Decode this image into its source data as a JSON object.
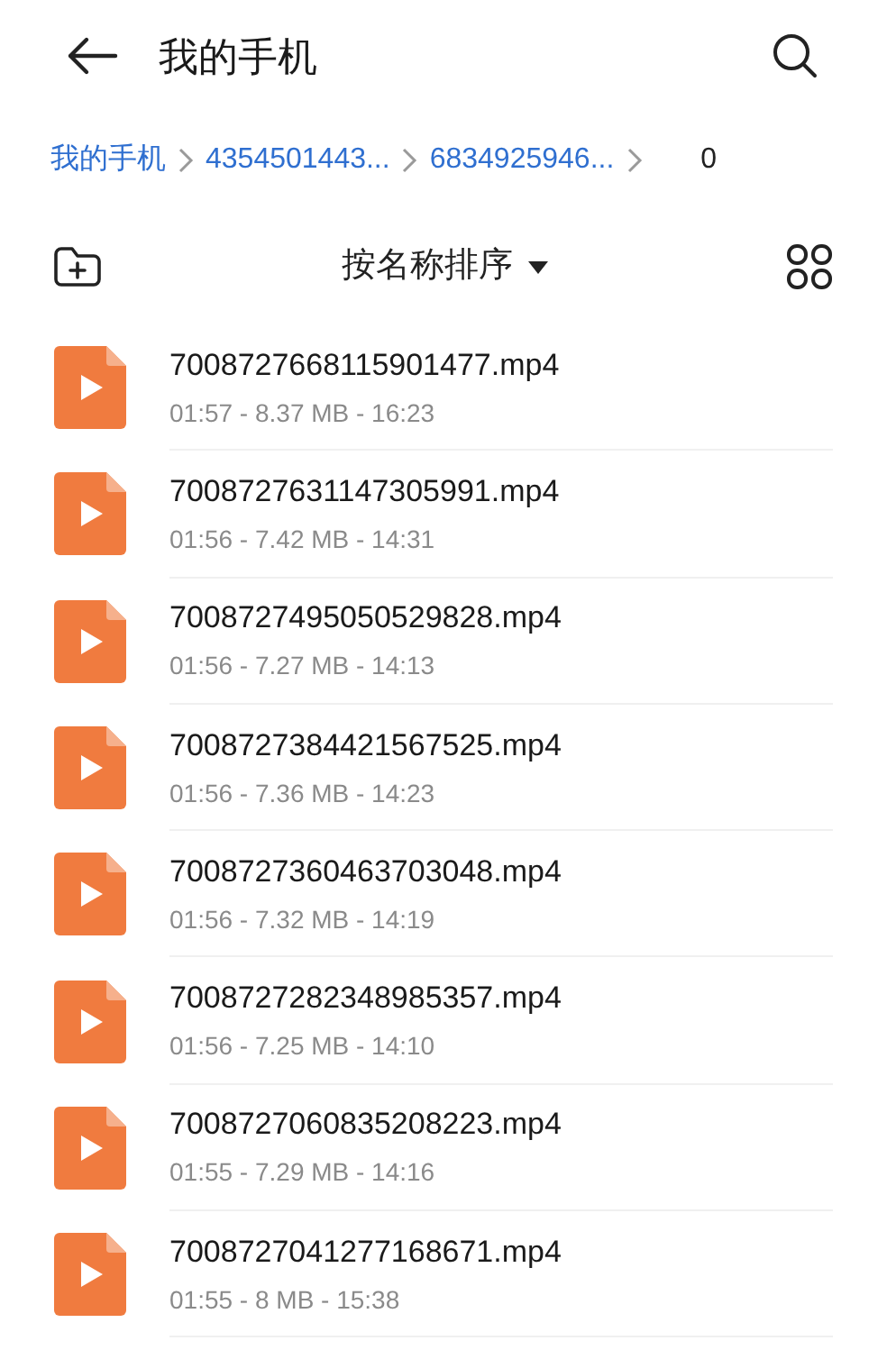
{
  "header": {
    "title": "我的手机"
  },
  "breadcrumbs": [
    {
      "label": "我的手机",
      "selected": false
    },
    {
      "label": "4354501443...",
      "selected": false
    },
    {
      "label": "6834925946...",
      "selected": false
    },
    {
      "label": "0",
      "selected": true
    }
  ],
  "toolbar": {
    "sort_label": "按名称排序"
  },
  "files": [
    {
      "name": "7008727668115901477.mp4",
      "meta": "01:57 - 8.37 MB - 16:23"
    },
    {
      "name": "7008727631147305991.mp4",
      "meta": "01:56 - 7.42 MB - 14:31"
    },
    {
      "name": "7008727495050529828.mp4",
      "meta": "01:56 - 7.27 MB - 14:13"
    },
    {
      "name": "7008727384421567525.mp4",
      "meta": "01:56 - 7.36 MB - 14:23"
    },
    {
      "name": "7008727360463703048.mp4",
      "meta": "01:56 - 7.32 MB - 14:19"
    },
    {
      "name": "7008727282348985357.mp4",
      "meta": "01:56 - 7.25 MB - 14:10"
    },
    {
      "name": "7008727060835208223.mp4",
      "meta": "01:55 - 7.29 MB - 14:16"
    },
    {
      "name": "7008727041277168671.mp4",
      "meta": "01:55 - 8 MB - 15:38"
    }
  ]
}
